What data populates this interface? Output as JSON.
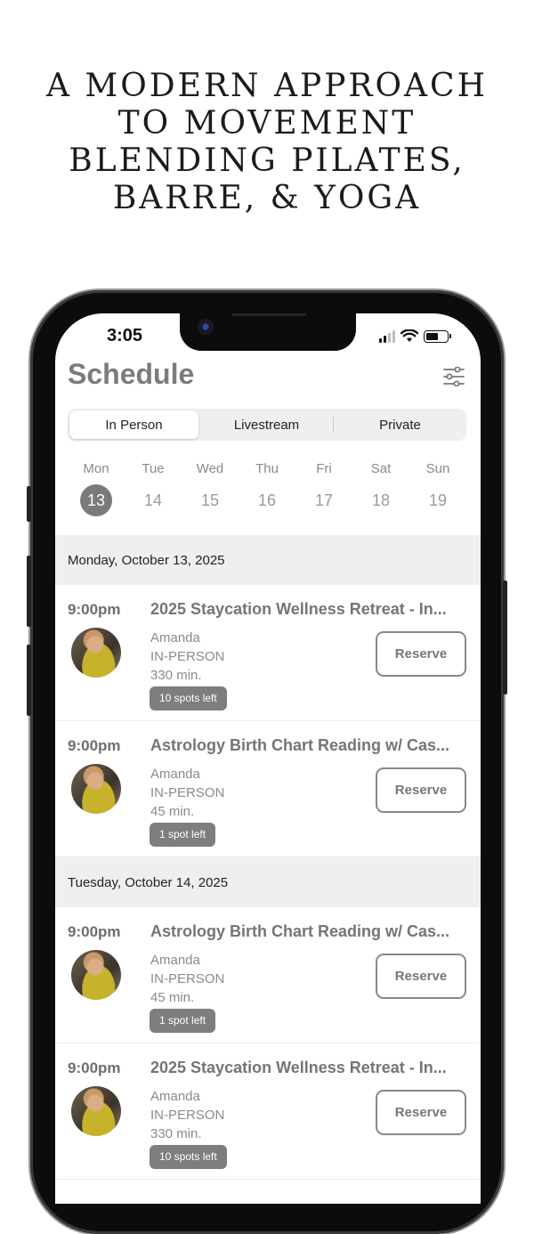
{
  "headline": {
    "lines": [
      "A MODERN APPROACH",
      "TO MOVEMENT",
      "BLENDING PILATES,",
      "BARRE, & YOGA"
    ]
  },
  "status_bar": {
    "time": "3:05"
  },
  "screen": {
    "title": "Schedule",
    "icons": {
      "filter": "sliders-icon",
      "signal": "signal-icon",
      "wifi": "wifi-icon",
      "battery": "battery-icon"
    },
    "tabs": [
      {
        "label": "In Person",
        "active": true
      },
      {
        "label": "Livestream",
        "active": false
      },
      {
        "label": "Private",
        "active": false
      }
    ],
    "week": [
      {
        "name": "Mon",
        "num": "13",
        "selected": true
      },
      {
        "name": "Tue",
        "num": "14",
        "selected": false
      },
      {
        "name": "Wed",
        "num": "15",
        "selected": false
      },
      {
        "name": "Thu",
        "num": "16",
        "selected": false
      },
      {
        "name": "Fri",
        "num": "17",
        "selected": false
      },
      {
        "name": "Sat",
        "num": "18",
        "selected": false
      },
      {
        "name": "Sun",
        "num": "19",
        "selected": false
      }
    ],
    "days": [
      {
        "date": "Monday, October 13, 2025",
        "sessions": [
          {
            "time": "9:00pm",
            "name": "2025 Staycation Wellness Retreat - In...",
            "instructor": "Amanda",
            "type": "IN-PERSON",
            "duration": "330 min.",
            "spots": "10 spots left",
            "reserve": "Reserve"
          },
          {
            "time": "9:00pm",
            "name": "Astrology Birth Chart Reading w/ Cas...",
            "instructor": "Amanda",
            "type": "IN-PERSON",
            "duration": "45 min.",
            "spots": "1 spot left",
            "reserve": "Reserve"
          }
        ]
      },
      {
        "date": "Tuesday, October 14, 2025",
        "sessions": [
          {
            "time": "9:00pm",
            "name": "Astrology Birth Chart Reading w/ Cas...",
            "instructor": "Amanda",
            "type": "IN-PERSON",
            "duration": "45 min.",
            "spots": "1 spot left",
            "reserve": "Reserve"
          },
          {
            "time": "9:00pm",
            "name": "2025 Staycation Wellness Retreat - In...",
            "instructor": "Amanda",
            "type": "IN-PERSON",
            "duration": "330 min.",
            "spots": "10 spots left",
            "reserve": "Reserve"
          }
        ]
      }
    ]
  },
  "colors": {
    "title_gray": "#7b7b7b",
    "selected_day": "#7a7a7a",
    "spots_badge": "#7e7e7e",
    "section_bg": "#efefef"
  }
}
